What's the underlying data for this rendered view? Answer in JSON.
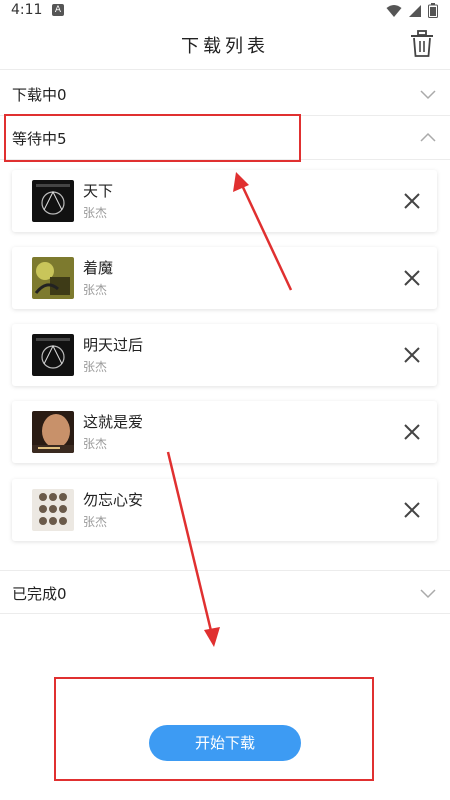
{
  "status_bar": {
    "time": "4:11",
    "notification_icon": "a-notification-icon",
    "icons": [
      "wifi-icon",
      "signal-icon",
      "battery-icon"
    ]
  },
  "header": {
    "title": "下载列表",
    "trash_icon": "trash-icon"
  },
  "sections": {
    "downloading": {
      "label": "下载中0",
      "expanded": false
    },
    "waiting": {
      "label": "等待中5",
      "expanded": true
    },
    "completed": {
      "label": "已完成0",
      "expanded": false
    }
  },
  "songs": [
    {
      "title": "天下",
      "artist": "张杰",
      "cover_color": "#111111"
    },
    {
      "title": "着魔",
      "artist": "张杰",
      "cover_color": "#8a8a3a"
    },
    {
      "title": "明天过后",
      "artist": "张杰",
      "cover_color": "#111111"
    },
    {
      "title": "这就是爱",
      "artist": "张杰",
      "cover_color": "#6b4a36"
    },
    {
      "title": "勿忘心安",
      "artist": "张杰",
      "cover_color": "#e8e4de"
    }
  ],
  "start_button": {
    "label": "开始下载",
    "color": "#3d9bf3"
  },
  "annotation_color": "#e03030"
}
